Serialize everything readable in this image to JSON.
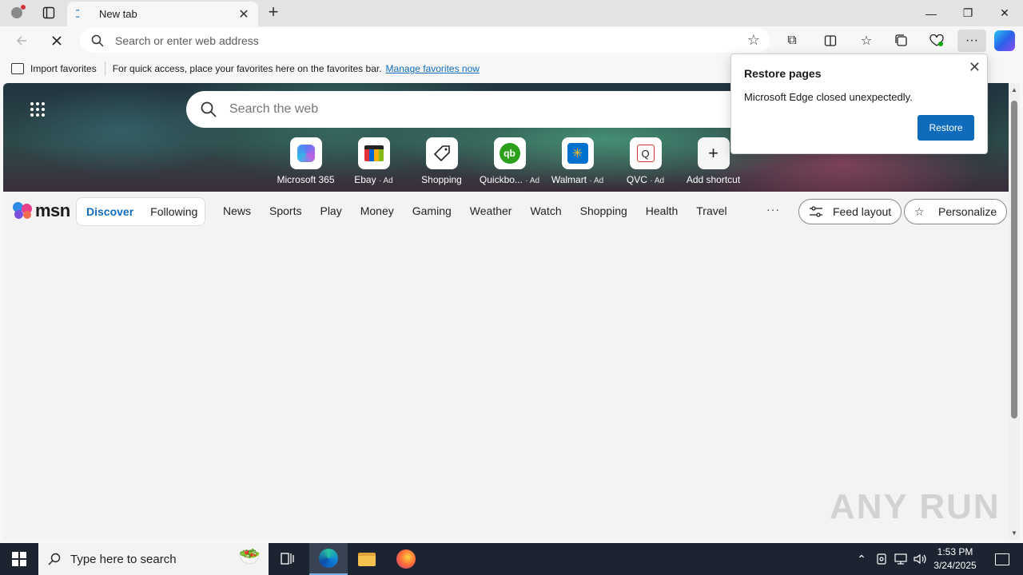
{
  "browser": {
    "tab": {
      "title": "New tab",
      "favicon": "loading-dots-icon",
      "close": "✕"
    },
    "new_tab_symbol": "+",
    "window": {
      "minimize": "—",
      "maximize": "❐",
      "close": "✕"
    },
    "address": {
      "placeholder": "Search or enter web address"
    }
  },
  "favorites_bar": {
    "import_label": "Import favorites",
    "hint": "For quick access, place your favorites here on the favorites bar.",
    "manage_link": "Manage favorites now"
  },
  "newtab": {
    "search_placeholder": "Search the web",
    "shortcuts": [
      {
        "label": "Microsoft 365",
        "ad": "",
        "icon": "microsoft-365-icon"
      },
      {
        "label": "Ebay",
        "ad": "· Ad",
        "icon": "ebay-icon"
      },
      {
        "label": "Shopping",
        "ad": "",
        "icon": "shopping-tag-icon"
      },
      {
        "label": "Quickbo...",
        "ad": "· Ad",
        "icon": "quickbooks-icon"
      },
      {
        "label": "Walmart",
        "ad": "· Ad",
        "icon": "walmart-icon"
      },
      {
        "label": "QVC",
        "ad": "· Ad",
        "icon": "qvc-icon"
      },
      {
        "label": "Add shortcut",
        "ad": "",
        "icon": "plus-icon"
      }
    ]
  },
  "msn": {
    "logo_text": "msn",
    "toggle": {
      "discover": "Discover",
      "following": "Following"
    },
    "nav": [
      "News",
      "Sports",
      "Play",
      "Money",
      "Gaming",
      "Weather",
      "Watch",
      "Shopping",
      "Health",
      "Travel"
    ],
    "more": "···",
    "feed_layout": "Feed layout",
    "personalize": "Personalize"
  },
  "restore_popup": {
    "title": "Restore pages",
    "message": "Microsoft Edge closed unexpectedly.",
    "button": "Restore"
  },
  "watermark": "ANY RUN",
  "taskbar": {
    "search_placeholder": "Type here to search",
    "time": "1:53 PM",
    "date": "3/24/2025"
  },
  "colors": {
    "accent": "#0f6cbd",
    "taskbar": "#1c2431"
  }
}
